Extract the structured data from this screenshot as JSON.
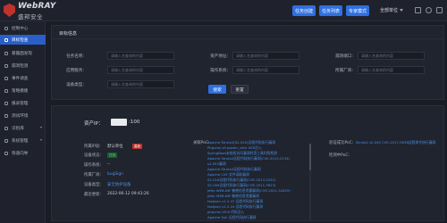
{
  "brand": {
    "name_en": "WebRAY",
    "name_cn": "盛邦安全"
  },
  "header": {
    "buttons": [
      "任务创建",
      "任务列表",
      "专家模式"
    ],
    "user": "全部单位"
  },
  "sidebar": {
    "items": [
      {
        "label": "控制中心",
        "active": false,
        "caret": false
      },
      {
        "label": "目标检查",
        "active": true,
        "caret": false
      },
      {
        "label": "暴露面发现",
        "active": false,
        "caret": false
      },
      {
        "label": "漏洞检测",
        "active": false,
        "caret": false
      },
      {
        "label": "事件调查",
        "active": false,
        "caret": false
      },
      {
        "label": "策略模版",
        "active": false,
        "caret": false
      },
      {
        "label": "报表管理",
        "active": false,
        "caret": false
      },
      {
        "label": "测试环境",
        "active": false,
        "caret": false
      },
      {
        "label": "识别库",
        "active": false,
        "caret": true
      },
      {
        "label": "系统管理",
        "active": false,
        "caret": true
      },
      {
        "label": "快速向导",
        "active": false,
        "caret": false
      }
    ]
  },
  "query": {
    "title": "目标信息",
    "fields": [
      {
        "label": "任务名称:",
        "placeholder": "请输入名查询的内容"
      },
      {
        "label": "资产地址:",
        "placeholder": "请输入名查询的内容"
      },
      {
        "label": "漏洞端口:",
        "placeholder": "请输入名查询的内容"
      },
      {
        "label": "应用服务:",
        "placeholder": "请输入名查询的内容"
      },
      {
        "label": "操作系统:",
        "placeholder": "请输入名查询的内容"
      },
      {
        "label": "所属厂商:",
        "placeholder": "请输入名查询的内容"
      },
      {
        "label": "设备类型:",
        "placeholder": "请输入名查询的内容"
      }
    ],
    "search_label": "搜索",
    "reset_label": "重置"
  },
  "detail": {
    "asset_label": "资产IP：",
    "asset_port": ":100",
    "rows": [
      {
        "label": "所属IP段:",
        "value": "默认单位"
      },
      {
        "label": "设备状态:",
        "value": "在线"
      },
      {
        "label": "操作系统:",
        "value": "--"
      },
      {
        "label": "所属厂商:",
        "value": "bugSign"
      },
      {
        "label": "设备类型:",
        "value": "安全防护设备"
      },
      {
        "label": "最近更新:",
        "value": "2022-06-12 09:43:26"
      }
    ],
    "danger_tag": "高危",
    "vuln_label": "关联PoC:",
    "vulns": [
      "Apache Struts2(S2-045)远程代码执行漏洞",
      "Phpcms v9 poster_click XSS注入",
      "SpringBoot未授权访问漏洞利用工具利用检测",
      "Apache Struts2远程代码执行漏洞(CVE-2013-2134)",
      "s2-053漏洞",
      "Apache Struts2远程代码执行漏洞",
      "Apache CXF 文件读取漏洞",
      "S2-016远程代码执行漏洞(CVE-2013-2251)",
      "S2-009远程代码执行漏洞(CVE-2011-3923)",
      "Jetty WEB-INF 敏感信息泄露漏洞(CVE-2021-34429)",
      "Jetty WEB-INF 敏感信息泄露漏洞",
      "fastjson v1.2.47 远程代码执行漏洞",
      "fastjson v1.2.24 远程代码执行漏洞",
      "phpcms V9.6 代码注入",
      "Apache Solr 远程代码执行漏洞"
    ],
    "right_rows": [
      {
        "label": "验证成功PoC:",
        "value": "Struts2 s2-045 CVE-2017-5638远程命令执行漏洞"
      },
      {
        "label": "检测中PoC:",
        "value": ""
      }
    ]
  }
}
